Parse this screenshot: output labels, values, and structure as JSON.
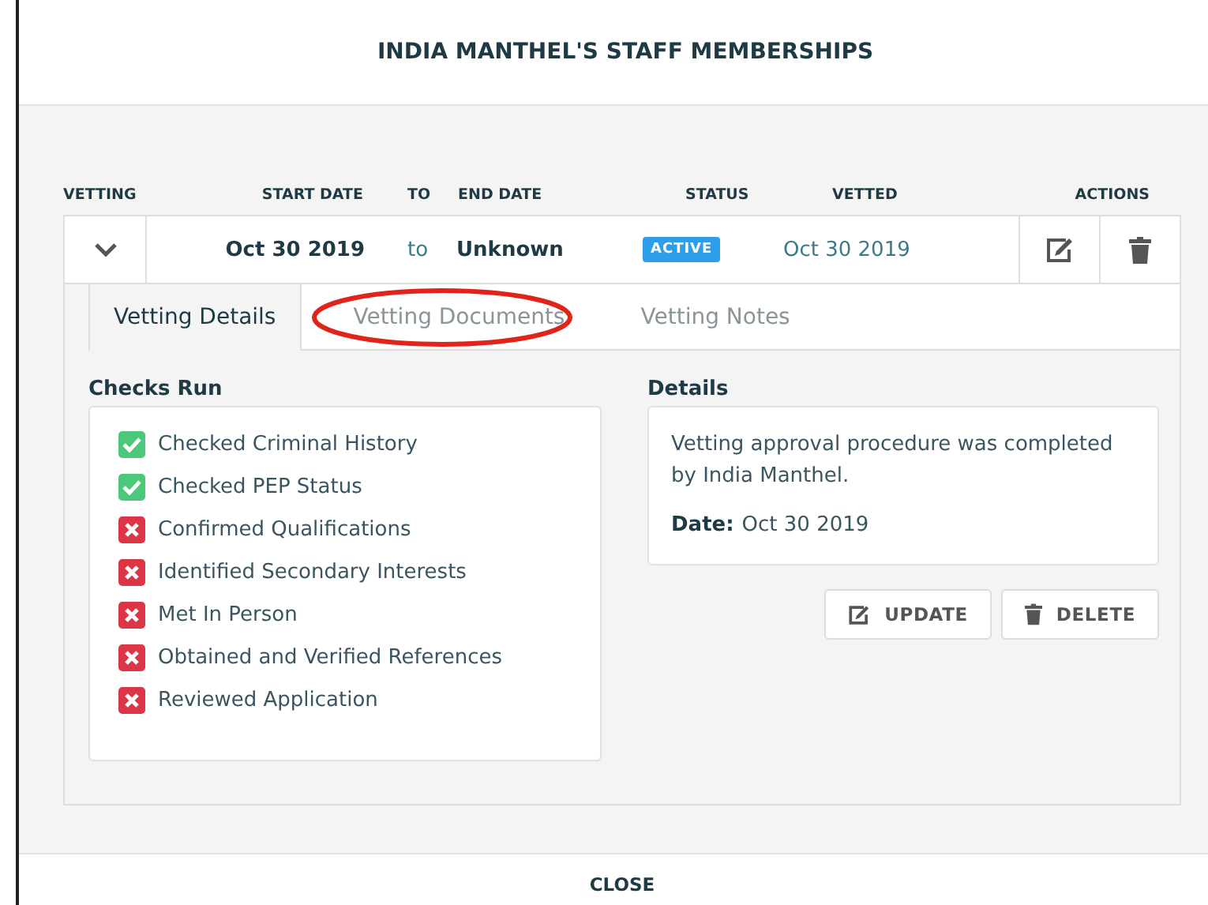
{
  "dialog": {
    "title": "INDIA MANTHEL'S STAFF MEMBERSHIPS"
  },
  "table": {
    "columns": [
      "VETTING",
      "START DATE",
      "TO",
      "END DATE",
      "STATUS",
      "VETTED",
      "ACTIONS"
    ],
    "row": {
      "expanded": true,
      "start_date": "Oct 30 2019",
      "to": "to",
      "end_date": "Unknown",
      "status": "ACTIVE",
      "vetted": "Oct 30 2019"
    }
  },
  "tabs": [
    {
      "label": "Vetting Details",
      "selected": true
    },
    {
      "label": "Vetting Documents",
      "selected": false,
      "circled": true
    },
    {
      "label": "Vetting Notes",
      "selected": false
    }
  ],
  "checks": {
    "heading": "Checks Run",
    "items": [
      {
        "label": "Checked Criminal History",
        "checked": true
      },
      {
        "label": "Checked PEP Status",
        "checked": true
      },
      {
        "label": "Confirmed Qualifications",
        "checked": false
      },
      {
        "label": "Identified Secondary Interests",
        "checked": false
      },
      {
        "label": "Met In Person",
        "checked": false
      },
      {
        "label": "Obtained and Verified References",
        "checked": false
      },
      {
        "label": "Reviewed Application",
        "checked": false
      }
    ]
  },
  "details": {
    "heading": "Details",
    "text": "Vetting approval procedure was completed by India Manthel.",
    "date_label": "Date:",
    "date": "Oct 30 2019"
  },
  "buttons": [
    {
      "label": "UPDATE",
      "kind": "edit"
    },
    {
      "label": "DELETE",
      "kind": "delete"
    }
  ],
  "footer": {
    "close": "CLOSE"
  }
}
